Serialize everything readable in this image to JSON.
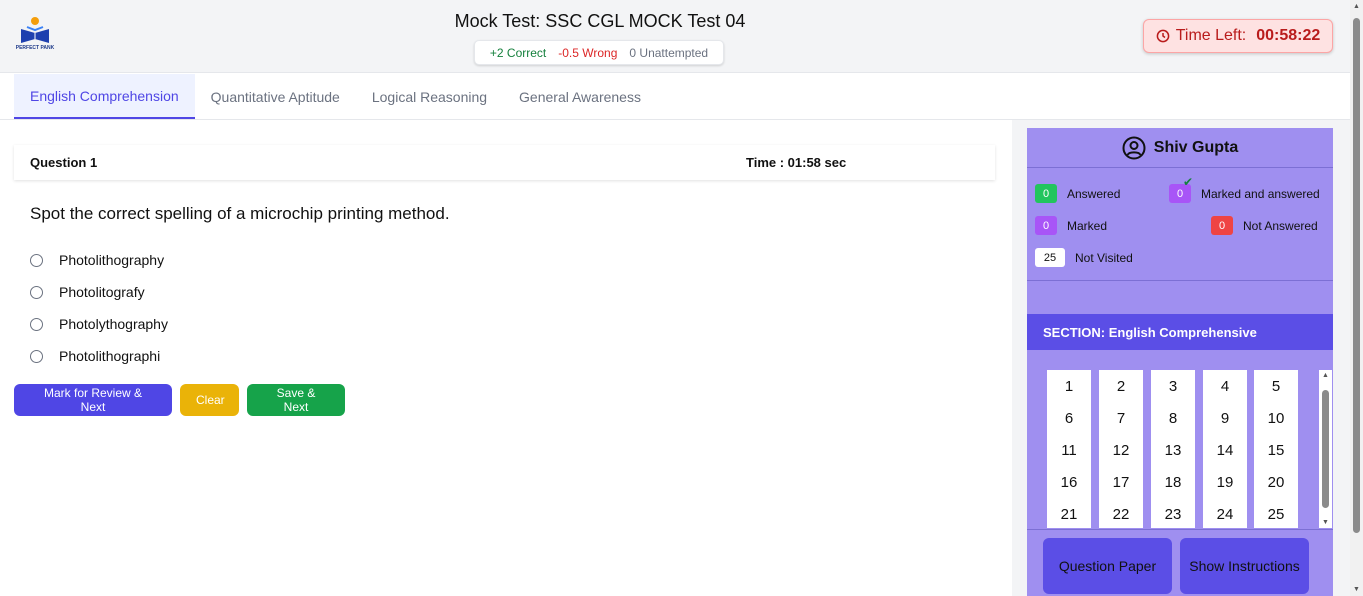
{
  "header": {
    "logo_text": "PERFECT PANK",
    "title": "Mock Test: SSC CGL MOCK Test 04",
    "scoring": {
      "correct": "+2 Correct",
      "wrong": "-0.5 Wrong",
      "unattempted": "0 Unattempted"
    },
    "timer": {
      "label": "Time Left:",
      "value": "00:58:22"
    }
  },
  "tabs": [
    {
      "label": "English Comprehension",
      "active": true
    },
    {
      "label": "Quantitative Aptitude",
      "active": false
    },
    {
      "label": "Logical Reasoning",
      "active": false
    },
    {
      "label": "General Awareness",
      "active": false
    }
  ],
  "question": {
    "number_label": "Question 1",
    "time_label": "Time : 01:58 sec",
    "text": "Spot the correct spelling of a microchip printing method.",
    "options": [
      "Photolithography",
      "Photolitografy",
      "Photolythography",
      "Photolithographi"
    ]
  },
  "actions": {
    "mark_review": "Mark for Review & Next",
    "clear": "Clear",
    "save_next": "Save & Next"
  },
  "sidebar": {
    "user_name": "Shiv Gupta",
    "legend": {
      "answered": {
        "count": "0",
        "label": "Answered"
      },
      "marked_answered": {
        "count": "0",
        "label": "Marked and answered"
      },
      "marked": {
        "count": "0",
        "label": "Marked"
      },
      "not_answered": {
        "count": "0",
        "label": "Not Answered"
      },
      "not_visited": {
        "count": "25",
        "label": "Not Visited"
      }
    },
    "section_title": "SECTION: English Comprehensive",
    "question_numbers": [
      "1",
      "2",
      "3",
      "4",
      "5",
      "6",
      "7",
      "8",
      "9",
      "10",
      "11",
      "12",
      "13",
      "14",
      "15",
      "16",
      "17",
      "18",
      "19",
      "20",
      "21",
      "22",
      "23",
      "24",
      "25"
    ],
    "question_paper": "Question Paper",
    "show_instructions": "Show Instructions"
  },
  "colors": {
    "accent": "#4f46e5",
    "panel": "#9f8ff0",
    "section": "#5b4ee6",
    "correct": "#15803d",
    "wrong": "#dc2626",
    "timer": "#b91c1c"
  }
}
